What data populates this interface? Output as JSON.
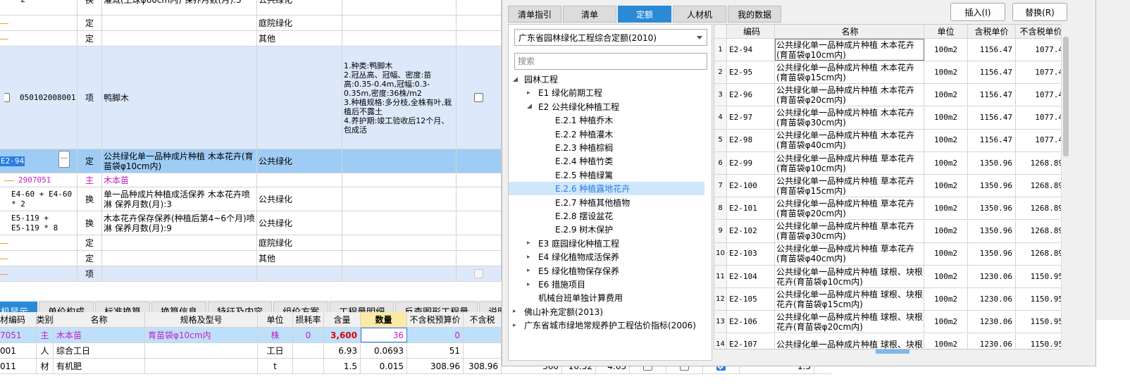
{
  "main_grid": {
    "rows": [
      {
        "code": "* 2",
        "type": "换",
        "name": "灌溉(土球φ60cm内)  保养月数(月):3",
        "profession": "公共绿化",
        "spec": "",
        "check": "none",
        "style": "normal",
        "code_style": "mono"
      },
      {
        "code": "",
        "type": "定",
        "name": "",
        "profession": "庭院绿化",
        "spec": "",
        "check": "none",
        "style": "normal",
        "code_style": "line"
      },
      {
        "code": "",
        "type": "定",
        "name": "",
        "profession": "其他",
        "spec": "",
        "check": "none",
        "style": "normal",
        "code_style": "line"
      },
      {
        "code": "050102008001",
        "type": "项",
        "name": "鸭脚木",
        "profession": "",
        "spec": "1.种类:鸭脚木\n2.冠丛高、冠幅、密度:苗高:0.35-0.4m,冠幅:0.3-0.35m,密度:36株/m2\n3.种植规格:多分枝,全株有叶,栽植后不露土\n4.养护期:竣工验收后12个月、包成活",
        "check": "box",
        "style": "list",
        "code_style": "mono"
      },
      {
        "code": "E2-94",
        "type": "定",
        "name": "公共绿化单一品种成片种植 木本花卉(育苗袋φ10cm内)",
        "profession": "公共绿化",
        "spec": "",
        "check": "none",
        "style": "selected",
        "code_style": "edit"
      },
      {
        "code": "2907051",
        "type": "主",
        "name": "木本苗",
        "profession": "",
        "spec": "",
        "check": "none",
        "style": "material",
        "code_style": "material"
      },
      {
        "code": "E4-60 + E4-60\n* 2",
        "type": "换",
        "name": "单一品种成片种植成活保养  木本花卉喷淋  保养月数(月):3",
        "profession": "公共绿化",
        "spec": "",
        "check": "none",
        "style": "normal",
        "code_style": "mono"
      },
      {
        "code": "E5-119 +\nE5-119 * 8",
        "type": "换",
        "name": "木本花卉保存保养(种植后第4~6个月)喷淋  保养月数(月):9",
        "profession": "公共绿化",
        "spec": "",
        "check": "none",
        "style": "normal",
        "code_style": "mono"
      },
      {
        "code": "",
        "type": "定",
        "name": "",
        "profession": "庭院绿化",
        "spec": "",
        "check": "none",
        "style": "normal",
        "code_style": "line"
      },
      {
        "code": "",
        "type": "定",
        "name": "",
        "profession": "其他",
        "spec": "",
        "check": "none",
        "style": "normal",
        "code_style": "line"
      },
      {
        "code": "",
        "type": "项",
        "name": "",
        "profession": "",
        "spec": "",
        "check": "dis",
        "style": "list",
        "code_style": "line"
      }
    ]
  },
  "bottom_tabs": [
    "机显示",
    "单价构成",
    "标准换算",
    "换算信息",
    "特征及内容",
    "组价方案",
    "工程量明细",
    "反查图形工程量",
    "说明"
  ],
  "detail_grid": {
    "headers": [
      "材编码",
      "类别",
      "名称",
      "规格及型号",
      "单位",
      "损耗率",
      "含量",
      "数量",
      "不含税预算价",
      "不含税"
    ],
    "rows": [
      {
        "code": "7051",
        "category": "主",
        "name": "木本苗",
        "spec": "育苗袋φ10cm内",
        "unit": "株",
        "loss": "0",
        "content": "3,600",
        "qty": "36",
        "price": "0",
        "price2": "",
        "extra": [],
        "checks": [],
        "selected": true
      },
      {
        "code": "001",
        "category": "人",
        "name": "综合工日",
        "spec": "",
        "unit": "工日",
        "loss": "",
        "content": "6.93",
        "qty": "0.0693",
        "price": "51",
        "price2": "",
        "extra": [],
        "checks": [],
        "selected": false
      },
      {
        "code": "011",
        "category": "材",
        "name": "有机肥",
        "spec": "",
        "unit": "t",
        "loss": "",
        "content": "1.5",
        "qty": "0.015",
        "price": "308.96",
        "price2": "308.96",
        "extra": [
          "360",
          "16.52",
          "4.63"
        ],
        "checks": [
          false,
          false,
          true
        ],
        "tail": "1.5",
        "selected": false
      }
    ]
  },
  "dialog": {
    "tabs": [
      "清单指引",
      "清单",
      "定额",
      "人材机",
      "我的数据"
    ],
    "active_tab": 2,
    "insert_button": "插入(I)",
    "replace_button": "替换(R)",
    "library_select": "广东省园林绿化工程综合定额(2010)",
    "search_placeholder": "搜索",
    "tree": [
      {
        "label": "园林工程",
        "level": 0,
        "arrow": "open"
      },
      {
        "label": "E1 绿化前期工程",
        "level": 1,
        "arrow": "closed"
      },
      {
        "label": "E2 公共绿化种植工程",
        "level": 1,
        "arrow": "open"
      },
      {
        "label": "E.2.1 种植乔木",
        "level": 2,
        "arrow": "none"
      },
      {
        "label": "E.2.2 种植灌木",
        "level": 2,
        "arrow": "none"
      },
      {
        "label": "E.2.3 种植棕榈",
        "level": 2,
        "arrow": "none"
      },
      {
        "label": "E.2.4 种植竹类",
        "level": 2,
        "arrow": "none"
      },
      {
        "label": "E.2.5 种植绿篱",
        "level": 2,
        "arrow": "none"
      },
      {
        "label": "E.2.6 种植露地花卉",
        "level": 2,
        "arrow": "none",
        "selected": true
      },
      {
        "label": "E.2.7 种植其他植物",
        "level": 2,
        "arrow": "none"
      },
      {
        "label": "E.2.8 摆设盆花",
        "level": 2,
        "arrow": "none"
      },
      {
        "label": "E.2.9 树木保护",
        "level": 2,
        "arrow": "none"
      },
      {
        "label": "E3 庭园绿化种植工程",
        "level": 1,
        "arrow": "closed"
      },
      {
        "label": "E4 绿化植物成活保养",
        "level": 1,
        "arrow": "closed"
      },
      {
        "label": "E5 绿化植物保存保养",
        "level": 1,
        "arrow": "closed"
      },
      {
        "label": "E6 措施项目",
        "level": 1,
        "arrow": "closed"
      },
      {
        "label": "机械台班单独计算费用",
        "level": 1,
        "arrow": "none"
      },
      {
        "label": "佛山补充定额(2013)",
        "level": 0,
        "arrow": "closed"
      },
      {
        "label": "广东省城市绿地常规养护工程估价指标(2006)",
        "level": 0,
        "arrow": "closed"
      }
    ],
    "result_headers": [
      "编码",
      "名称",
      "单位",
      "含税单价",
      "不含税单价"
    ],
    "results": [
      {
        "no": "1",
        "code": "E2-94",
        "name": "公共绿化单一品种成片种植 木本花卉(育苗袋φ10cm内)",
        "unit": "100m2",
        "price_tax": "1156.47",
        "price_notax": "1077.4"
      },
      {
        "no": "2",
        "code": "E2-95",
        "name": "公共绿化单一品种成片种植 木本花卉(育苗袋φ15cm内)",
        "unit": "100m2",
        "price_tax": "1156.47",
        "price_notax": "1077.4"
      },
      {
        "no": "3",
        "code": "E2-96",
        "name": "公共绿化单一品种成片种植 木本花卉(育苗袋φ20cm内)",
        "unit": "100m2",
        "price_tax": "1156.47",
        "price_notax": "1077.4"
      },
      {
        "no": "4",
        "code": "E2-97",
        "name": "公共绿化单一品种成片种植 木本花卉(育苗袋φ30cm内)",
        "unit": "100m2",
        "price_tax": "1156.47",
        "price_notax": "1077.4"
      },
      {
        "no": "5",
        "code": "E2-98",
        "name": "公共绿化单一品种成片种植 木本花卉(育苗袋φ40cm内)",
        "unit": "100m2",
        "price_tax": "1156.47",
        "price_notax": "1077.4"
      },
      {
        "no": "6",
        "code": "E2-99",
        "name": "公共绿化单一品种成片种植 草本花卉(育苗袋φ10cm内)",
        "unit": "100m2",
        "price_tax": "1350.96",
        "price_notax": "1268.89"
      },
      {
        "no": "7",
        "code": "E2-100",
        "name": "公共绿化单一品种成片种植 草本花卉(育苗袋φ15cm内)",
        "unit": "100m2",
        "price_tax": "1350.96",
        "price_notax": "1268.89"
      },
      {
        "no": "8",
        "code": "E2-101",
        "name": "公共绿化单一品种成片种植 草本花卉(育苗袋φ20cm内)",
        "unit": "100m2",
        "price_tax": "1350.96",
        "price_notax": "1268.89"
      },
      {
        "no": "9",
        "code": "E2-102",
        "name": "公共绿化单一品种成片种植 草本花卉(育苗袋φ30cm内)",
        "unit": "100m2",
        "price_tax": "1350.96",
        "price_notax": "1268.89"
      },
      {
        "no": "10",
        "code": "E2-103",
        "name": "公共绿化单一品种成片种植 草本花卉(育苗袋φ40cm内)",
        "unit": "100m2",
        "price_tax": "1350.96",
        "price_notax": "1268.89"
      },
      {
        "no": "11",
        "code": "E2-104",
        "name": "公共绿化单一品种成片种植 球根、块根花卉(育苗袋φ10cm内)",
        "unit": "100m2",
        "price_tax": "1230.06",
        "price_notax": "1150.95"
      },
      {
        "no": "12",
        "code": "E2-105",
        "name": "公共绿化单一品种成片种植 球根、块根花卉(育苗袋φ15cm内)",
        "unit": "100m2",
        "price_tax": "1230.06",
        "price_notax": "1150.95"
      },
      {
        "no": "13",
        "code": "E2-106",
        "name": "公共绿化单一品种成片种植 球根、块根花卉(育苗袋φ20cm内)",
        "unit": "100m2",
        "price_tax": "1230.06",
        "price_notax": "1150.95"
      },
      {
        "no": "14",
        "code": "E2-107",
        "name": "公共绿化单一品种成片种植 球根、块根",
        "unit": "100m2",
        "price_tax": "1230.06",
        "price_notax": "1150.95"
      }
    ]
  },
  "colors": {
    "accent": "#2a8ad6",
    "selected_row": "#9fccf5",
    "list_row": "#dde9fa",
    "material_text": "#c020c0",
    "tree_line": "#e8a040"
  }
}
